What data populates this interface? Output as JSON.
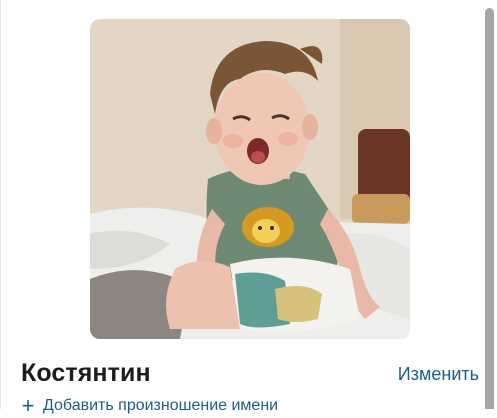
{
  "profile": {
    "name": "Костянтин",
    "edit_label": "Изменить",
    "add_pronunciation_label": "Добавить произношение имени",
    "add_icon": "plus-icon",
    "photo_subject": "profile-photo"
  },
  "colors": {
    "link": "#1b5e86",
    "name_text": "#1d1d1d",
    "scroll_thumb": "#a6a6a6"
  }
}
